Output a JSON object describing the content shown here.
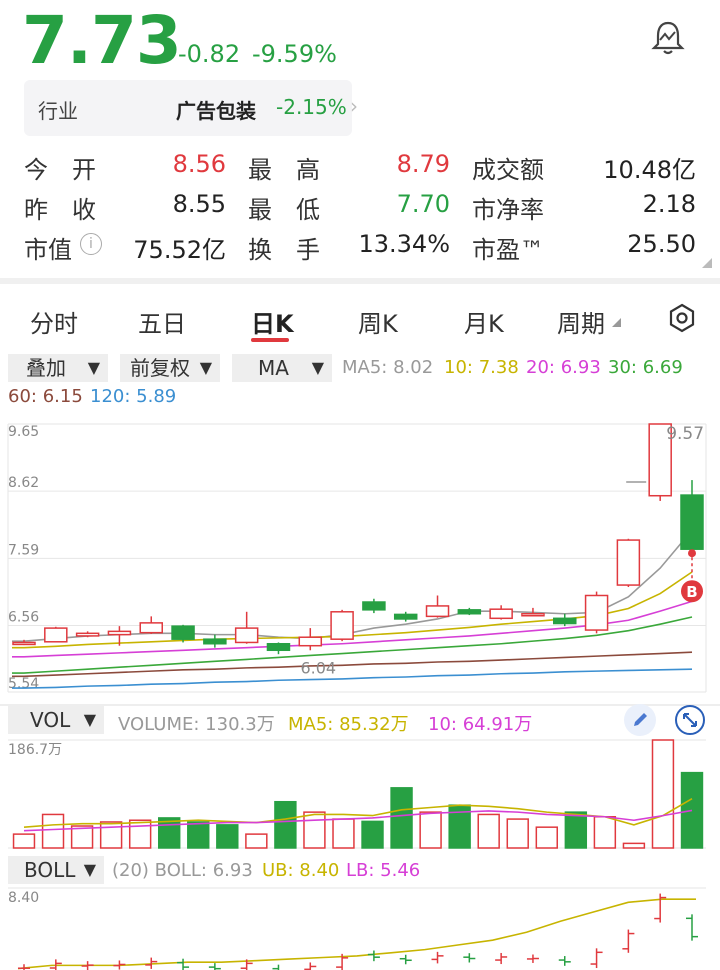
{
  "header": {
    "price": "7.73",
    "change": "-0.82",
    "change_pct": "-9.59%",
    "industry_label": "行业",
    "industry_name": "广告包装",
    "industry_pct": "-2.15%"
  },
  "stats": [
    {
      "label": "今　开",
      "value": "8.56",
      "color": "#e0393e"
    },
    {
      "label": "最　高",
      "value": "8.79",
      "color": "#e0393e"
    },
    {
      "label": "成交额",
      "value": "10.48亿",
      "color": "#222222"
    },
    {
      "label": "昨　收",
      "value": "8.55",
      "color": "#222222"
    },
    {
      "label": "最　低",
      "value": "7.70",
      "color": "#27a043"
    },
    {
      "label": "市净率",
      "value": "2.18",
      "color": "#222222"
    },
    {
      "label": "市值",
      "value": "75.52亿",
      "color": "#222222"
    },
    {
      "label": "换　手",
      "value": "13.34%",
      "color": "#222222"
    },
    {
      "label": "市盈™",
      "value": "25.50",
      "color": "#222222"
    }
  ],
  "tabs": [
    "分时",
    "五日",
    "日K",
    "周K",
    "月K",
    "周期"
  ],
  "active_tab": "日K",
  "controls": {
    "overlay": "叠加",
    "adjust": "前复权",
    "indicator": "MA",
    "vol": "VOL",
    "boll": "BOLL"
  },
  "ma_legend": {
    "ma5": "MA5: 8.02",
    "ma10": "10: 7.38",
    "ma20": "20: 6.93",
    "ma30": "30: 6.69",
    "ma60": "60: 6.15",
    "ma120": "120: 5.89"
  },
  "vol_legend": {
    "volume": "VOLUME: 130.3万",
    "ma5": "MA5: 85.32万",
    "ma10": "10: 64.91万"
  },
  "boll_legend": {
    "period": "(20) BOLL: 6.93",
    "ub": "UB: 8.40",
    "lb": "LB: 5.46"
  },
  "colors": {
    "up": "#e0393e",
    "down": "#27a043",
    "ma5": "#999999",
    "ma10": "#c7b400",
    "ma20": "#d63fd6",
    "ma30": "#3aa83a",
    "ma60": "#8b4a3c",
    "ma120": "#3b8fd1"
  },
  "chart_data": [
    {
      "type": "candlestick",
      "y_ticks": [
        "9.65",
        "8.62",
        "7.59",
        "6.56",
        "5.54"
      ],
      "ylim": [
        5.54,
        9.65
      ],
      "annotations": {
        "high": "9.57",
        "low": "6.04",
        "marker": "B"
      },
      "candles": [
        {
          "o": 6.3,
          "c": 6.3,
          "h": 6.34,
          "l": 6.26
        },
        {
          "o": 6.31,
          "c": 6.52,
          "h": 6.54,
          "l": 6.3
        },
        {
          "o": 6.4,
          "c": 6.44,
          "h": 6.47,
          "l": 6.38
        },
        {
          "o": 6.42,
          "c": 6.47,
          "h": 6.55,
          "l": 6.25
        },
        {
          "o": 6.45,
          "c": 6.6,
          "h": 6.7,
          "l": 6.43
        },
        {
          "o": 6.55,
          "c": 6.35,
          "h": 6.57,
          "l": 6.3
        },
        {
          "o": 6.35,
          "c": 6.28,
          "h": 6.42,
          "l": 6.22
        },
        {
          "o": 6.3,
          "c": 6.52,
          "h": 6.77,
          "l": 6.28
        },
        {
          "o": 6.28,
          "c": 6.18,
          "h": 6.3,
          "l": 6.12
        },
        {
          "o": 6.25,
          "c": 6.38,
          "h": 6.52,
          "l": 6.18
        },
        {
          "o": 6.35,
          "c": 6.77,
          "h": 6.8,
          "l": 6.32
        },
        {
          "o": 6.92,
          "c": 6.8,
          "h": 6.97,
          "l": 6.75
        },
        {
          "o": 6.73,
          "c": 6.66,
          "h": 6.77,
          "l": 6.62
        },
        {
          "o": 6.7,
          "c": 6.86,
          "h": 7.02,
          "l": 6.68
        },
        {
          "o": 6.8,
          "c": 6.74,
          "h": 6.83,
          "l": 6.72
        },
        {
          "o": 6.67,
          "c": 6.81,
          "h": 6.87,
          "l": 6.65
        },
        {
          "o": 6.72,
          "c": 6.74,
          "h": 6.83,
          "l": 6.7
        },
        {
          "o": 6.67,
          "c": 6.59,
          "h": 6.74,
          "l": 6.55
        },
        {
          "o": 6.49,
          "c": 7.02,
          "h": 7.08,
          "l": 6.44
        },
        {
          "o": 7.18,
          "c": 7.87,
          "h": 7.89,
          "l": 7.15
        },
        {
          "o": 8.55,
          "c": 9.65,
          "h": 9.65,
          "l": 8.47
        },
        {
          "o": 8.56,
          "c": 7.73,
          "h": 8.79,
          "l": 7.7
        }
      ],
      "ma": {
        "ma5": [
          6.32,
          6.36,
          6.4,
          6.42,
          6.44,
          6.44,
          6.42,
          6.42,
          6.38,
          6.36,
          6.42,
          6.52,
          6.58,
          6.66,
          6.78,
          6.78,
          6.76,
          6.74,
          6.76,
          7.0,
          7.44,
          8.02
        ],
        "ma10": [
          6.22,
          6.24,
          6.27,
          6.29,
          6.31,
          6.33,
          6.35,
          6.36,
          6.37,
          6.38,
          6.39,
          6.42,
          6.45,
          6.49,
          6.53,
          6.58,
          6.62,
          6.66,
          6.71,
          6.82,
          7.05,
          7.38
        ],
        "ma20": [
          6.08,
          6.1,
          6.12,
          6.14,
          6.16,
          6.18,
          6.2,
          6.22,
          6.24,
          6.26,
          6.28,
          6.31,
          6.34,
          6.37,
          6.4,
          6.44,
          6.48,
          6.52,
          6.57,
          6.64,
          6.78,
          6.93
        ],
        "ma30": [
          5.83,
          5.86,
          5.89,
          5.92,
          5.95,
          5.98,
          6.01,
          6.04,
          6.07,
          6.1,
          6.13,
          6.16,
          6.19,
          6.22,
          6.25,
          6.28,
          6.32,
          6.36,
          6.41,
          6.48,
          6.58,
          6.69
        ],
        "ma60": [
          5.78,
          5.8,
          5.82,
          5.84,
          5.86,
          5.88,
          5.89,
          5.91,
          5.92,
          5.94,
          5.95,
          5.97,
          5.98,
          6.0,
          6.01,
          6.03,
          6.05,
          6.07,
          6.09,
          6.11,
          6.13,
          6.15
        ],
        "ma120": [
          5.6,
          5.61,
          5.63,
          5.64,
          5.66,
          5.67,
          5.69,
          5.7,
          5.72,
          5.73,
          5.74,
          5.76,
          5.77,
          5.79,
          5.8,
          5.82,
          5.83,
          5.85,
          5.86,
          5.87,
          5.88,
          5.89
        ]
      }
    },
    {
      "type": "bar",
      "name": "VOL",
      "y_ticks": [
        "186.7万"
      ],
      "ylim": [
        0,
        186.7
      ],
      "values": [
        24,
        58,
        38,
        45,
        48,
        52,
        45,
        40,
        24,
        80,
        62,
        50,
        46,
        104,
        62,
        74,
        58,
        50,
        36,
        62,
        54,
        8,
        186.7,
        130.3
      ],
      "ma5": [
        36,
        40,
        42,
        42,
        44,
        46,
        48,
        46,
        44,
        50,
        58,
        58,
        56,
        66,
        70,
        74,
        72,
        68,
        62,
        58,
        54,
        40,
        56,
        85.32
      ],
      "ma10": [
        30,
        32,
        34,
        36,
        38,
        40,
        42,
        44,
        44,
        46,
        48,
        50,
        52,
        56,
        60,
        62,
        64,
        62,
        58,
        56,
        54,
        48,
        56,
        64.91
      ]
    },
    {
      "type": "line",
      "name": "BOLL",
      "y_ticks": [
        "8.40"
      ],
      "ub_line": [
        6.2,
        6.3,
        6.3,
        6.3,
        6.35,
        6.4,
        6.4,
        6.45,
        6.5,
        6.55,
        6.6,
        6.7,
        6.8,
        6.95,
        7.1,
        7.35,
        7.7,
        8.0,
        8.3,
        8.4,
        8.4
      ]
    }
  ]
}
